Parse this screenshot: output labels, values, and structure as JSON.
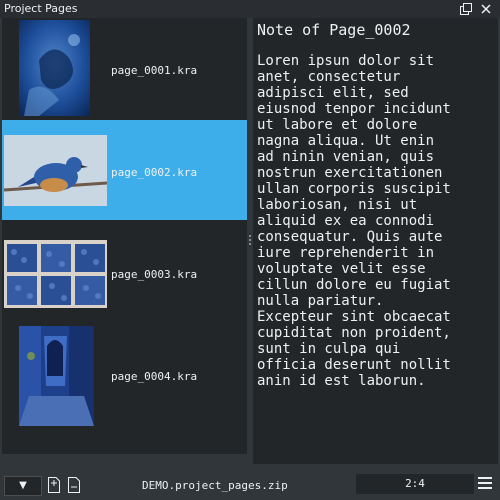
{
  "window": {
    "title": "Project Pages"
  },
  "pages": [
    {
      "file": "page_0001.kra",
      "selected": false
    },
    {
      "file": "page_0002.kra",
      "selected": true
    },
    {
      "file": "page_0003.kra",
      "selected": false
    },
    {
      "file": "page_0004.kra",
      "selected": false
    }
  ],
  "note": {
    "title": "Note of Page_0002",
    "body": "Loren ipsun dolor sit\nanet, consectetur\nadipisci elit, sed\neiusnod tenpor incidunt\nut labore et dolore\nnagna aliqua. Ut enin\nad ninin venian, quis\nnostrun exercitationen\nullan corporis suscipit\nlaboriosan, nisi ut\naliquid ex ea connodi\nconsequatur. Quis aute\niure reprehenderit in\nvoluptate velit esse\ncillun dolore eu fugiat\nnulla pariatur.\nExcepteur sint obcaecat\ncupiditat non proident,\nsunt in culpa qui\nofficia deserunt nollit\nanin id est laborun."
  },
  "statusbar": {
    "dropdown_symbol": "▼",
    "document": "DEMO.project_pages.zip",
    "page_counter": "2:4"
  },
  "colors": {
    "selection": "#3daee9",
    "panel": "#232629",
    "background": "#31363b"
  },
  "icons": [
    "float-icon",
    "close-icon",
    "add-page-icon",
    "remove-page-icon",
    "hamburger-menu-icon"
  ]
}
